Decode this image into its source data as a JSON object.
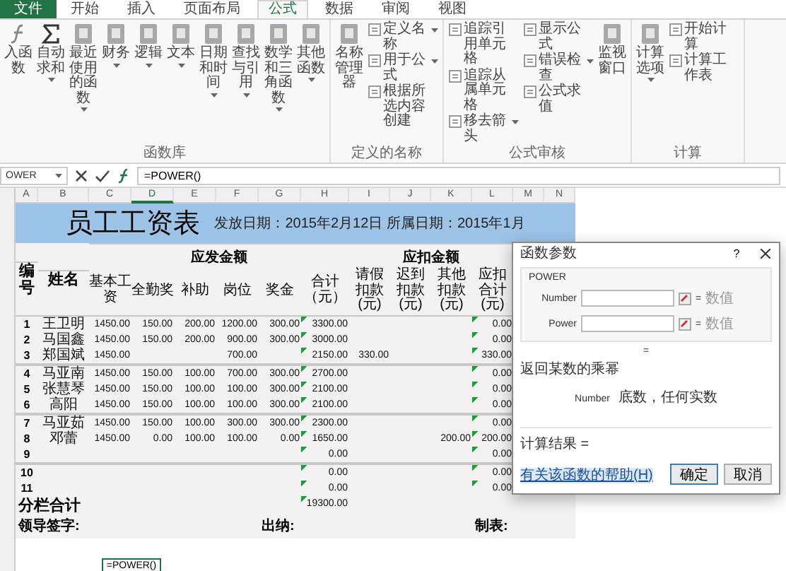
{
  "tabs": [
    {
      "label": "文件",
      "kind": "file",
      "selected": false
    },
    {
      "label": "开始",
      "kind": "tab",
      "selected": false
    },
    {
      "label": "插入",
      "kind": "tab",
      "selected": false
    },
    {
      "label": "页面布局",
      "kind": "tab",
      "selected": false
    },
    {
      "label": "公式",
      "kind": "tab",
      "selected": true
    },
    {
      "label": "数据",
      "kind": "tab",
      "selected": false
    },
    {
      "label": "审阅",
      "kind": "tab",
      "selected": false
    },
    {
      "label": "视图",
      "kind": "tab",
      "selected": false
    }
  ],
  "ribbon": {
    "groups": [
      {
        "label": "函数库",
        "items": [
          {
            "label": "入函数",
            "kind": "large",
            "dropdown": false
          },
          {
            "label": "自动求和",
            "kind": "large",
            "dropdown": true
          },
          {
            "label": "最近使用的函数",
            "kind": "large",
            "dropdown": true
          },
          {
            "label": "财务",
            "kind": "large",
            "dropdown": true
          },
          {
            "label": "逻辑",
            "kind": "large",
            "dropdown": true
          },
          {
            "label": "文本",
            "kind": "large",
            "dropdown": true
          },
          {
            "label": "日期和时间",
            "kind": "large",
            "dropdown": true
          },
          {
            "label": "查找与引用",
            "kind": "large",
            "dropdown": true
          },
          {
            "label": "数学和三角函数",
            "kind": "large",
            "dropdown": true
          },
          {
            "label": "其他函数",
            "kind": "large",
            "dropdown": true
          }
        ]
      },
      {
        "label": "定义的名称",
        "items": [
          {
            "label": "名称管理器",
            "kind": "large",
            "dropdown": false
          },
          {
            "label": "定义名称",
            "kind": "small",
            "dropdown": true
          },
          {
            "label": "用于公式",
            "kind": "small",
            "dropdown": true
          },
          {
            "label": "根据所选内容创建",
            "kind": "small",
            "dropdown": false
          }
        ]
      },
      {
        "label": "公式审核",
        "items": [
          {
            "label": "追踪引用单元格",
            "kind": "small",
            "dropdown": false
          },
          {
            "label": "追踪从属单元格",
            "kind": "small",
            "dropdown": false
          },
          {
            "label": "移去箭头",
            "kind": "small",
            "dropdown": true
          },
          {
            "label": "显示公式",
            "kind": "small",
            "dropdown": false
          },
          {
            "label": "错误检查",
            "kind": "small",
            "dropdown": true
          },
          {
            "label": "公式求值",
            "kind": "small",
            "dropdown": false
          },
          {
            "label": "监视窗口",
            "kind": "large",
            "dropdown": false
          }
        ]
      },
      {
        "label": "计算",
        "items": [
          {
            "label": "计算选项",
            "kind": "large",
            "dropdown": true
          },
          {
            "label": "开始计算",
            "kind": "small",
            "dropdown": false
          },
          {
            "label": "计算工作表",
            "kind": "small",
            "dropdown": false
          }
        ]
      }
    ]
  },
  "formula_bar": {
    "name_box": "OWER",
    "formula": "=POWER()"
  },
  "sheet": {
    "column_letters": [
      "A",
      "B",
      "C",
      "D",
      "E",
      "F",
      "G",
      "H",
      "I",
      "J",
      "K",
      "L",
      "M",
      "N"
    ],
    "title": "员工工资表",
    "subtitle": "发放日期：2015年2月12日 所属日期：2015年1月",
    "id_header": "编号",
    "name_header": "姓名",
    "header_groups": [
      {
        "label": "应发金额",
        "columns": [
          "基本工资",
          "全勤奖",
          "补助",
          "岗位",
          "奖金",
          "合计（元）"
        ]
      },
      {
        "label": "应扣金额",
        "columns": [
          "请假扣款(元)",
          "迟到扣款(元)",
          "其他扣款(元)",
          "应扣合计(元)"
        ]
      }
    ],
    "rows": [
      {
        "no": "1",
        "name": "王卫明",
        "cells": {
          "C": {
            "text": "1450.00",
            "flagged": false
          },
          "D": {
            "text": "150.00",
            "flagged": false
          },
          "E": {
            "text": "200.00",
            "flagged": false
          },
          "F": {
            "text": "1200.00",
            "flagged": false
          },
          "G": {
            "text": "300.00",
            "flagged": false
          },
          "H": {
            "text": "3300.00",
            "flagged": true
          },
          "L": {
            "text": "0.00",
            "flagged": true
          }
        }
      },
      {
        "no": "2",
        "name": "马国鑫",
        "cells": {
          "C": {
            "text": "1450.00",
            "flagged": false
          },
          "D": {
            "text": "150.00",
            "flagged": false
          },
          "E": {
            "text": "200.00",
            "flagged": false
          },
          "F": {
            "text": "900.00",
            "flagged": false
          },
          "G": {
            "text": "300.00",
            "flagged": false
          },
          "H": {
            "text": "3000.00",
            "flagged": true
          },
          "L": {
            "text": "0.00",
            "flagged": true
          }
        }
      },
      {
        "no": "3",
        "name": "郑国斌",
        "cells": {
          "C": {
            "text": "1450.00",
            "flagged": false
          },
          "F": {
            "text": "700.00",
            "flagged": false
          },
          "H": {
            "text": "2150.00",
            "flagged": true
          },
          "I": {
            "text": "330.00",
            "flagged": false
          },
          "L": {
            "text": "330.00",
            "flagged": true
          }
        }
      },
      {
        "no": "4",
        "name": "马亚南",
        "cells": {
          "C": {
            "text": "1450.00",
            "flagged": false
          },
          "D": {
            "text": "150.00",
            "flagged": false
          },
          "E": {
            "text": "100.00",
            "flagged": false
          },
          "F": {
            "text": "700.00",
            "flagged": false
          },
          "G": {
            "text": "300.00",
            "flagged": false
          },
          "H": {
            "text": "2700.00",
            "flagged": true
          },
          "L": {
            "text": "0.00",
            "flagged": true
          }
        }
      },
      {
        "no": "5",
        "name": "张慧琴",
        "cells": {
          "C": {
            "text": "1450.00",
            "flagged": false
          },
          "D": {
            "text": "150.00",
            "flagged": false
          },
          "E": {
            "text": "100.00",
            "flagged": false
          },
          "F": {
            "text": "100.00",
            "flagged": false
          },
          "G": {
            "text": "300.00",
            "flagged": false
          },
          "H": {
            "text": "2100.00",
            "flagged": true
          },
          "L": {
            "text": "0.00",
            "flagged": true
          }
        }
      },
      {
        "no": "6",
        "name": "高阳",
        "cells": {
          "C": {
            "text": "1450.00",
            "flagged": false
          },
          "D": {
            "text": "150.00",
            "flagged": false
          },
          "E": {
            "text": "100.00",
            "flagged": false
          },
          "F": {
            "text": "100.00",
            "flagged": false
          },
          "G": {
            "text": "300.00",
            "flagged": false
          },
          "H": {
            "text": "2100.00",
            "flagged": true
          },
          "L": {
            "text": "0.00",
            "flagged": true
          }
        }
      },
      {
        "no": "7",
        "name": "马亚茹",
        "cells": {
          "C": {
            "text": "1450.00",
            "flagged": false
          },
          "D": {
            "text": "150.00",
            "flagged": false
          },
          "E": {
            "text": "100.00",
            "flagged": false
          },
          "F": {
            "text": "300.00",
            "flagged": false
          },
          "G": {
            "text": "300.00",
            "flagged": false
          },
          "H": {
            "text": "2300.00",
            "flagged": true
          },
          "L": {
            "text": "0.00",
            "flagged": true
          }
        }
      },
      {
        "no": "8",
        "name": "邓蕾",
        "cells": {
          "C": {
            "text": "1450.00",
            "flagged": false
          },
          "D": {
            "text": "0.00",
            "flagged": false
          },
          "E": {
            "text": "100.00",
            "flagged": false
          },
          "F": {
            "text": "100.00",
            "flagged": false
          },
          "G": {
            "text": "0.00",
            "flagged": false
          },
          "H": {
            "text": "1650.00",
            "flagged": true
          },
          "K": {
            "text": "200.00",
            "flagged": false
          },
          "L": {
            "text": "200.00",
            "flagged": true
          }
        }
      },
      {
        "no": "9",
        "cells": {
          "H": {
            "text": "0.00",
            "flagged": true
          },
          "L": {
            "text": "0.00",
            "flagged": true
          }
        }
      },
      {
        "no": "10",
        "cells": {
          "H": {
            "text": "0.00",
            "flagged": true
          },
          "L": {
            "text": "0.00",
            "flagged": true
          }
        }
      },
      {
        "no": "11",
        "cells": {
          "H": {
            "text": "0.00",
            "flagged": true
          },
          "L": {
            "text": "0.00",
            "flagged": true
          }
        }
      }
    ],
    "total": {
      "label": "分栏合计",
      "value": "19300.00",
      "flagged": true
    },
    "signatures": [
      "领导签字:",
      "出纳:",
      "制表:"
    ],
    "edit_cell": "=POWER()"
  },
  "dialog": {
    "title": "函数参数",
    "help": "?",
    "function": "POWER",
    "args": [
      {
        "label": "Number",
        "sign": "=",
        "hint": "数值"
      },
      {
        "label": "Power",
        "sign": "=",
        "hint": "数值"
      }
    ],
    "result_sign": "=",
    "description": "返回某数的乘幂",
    "arg_name": "Number",
    "arg_desc": "底数，任何实数",
    "result_label": "计算结果 =",
    "help_link": "有关该函数的帮助(H)",
    "buttons": [
      {
        "label": "确定",
        "default": true
      },
      {
        "label": "取消",
        "default": false
      }
    ]
  }
}
